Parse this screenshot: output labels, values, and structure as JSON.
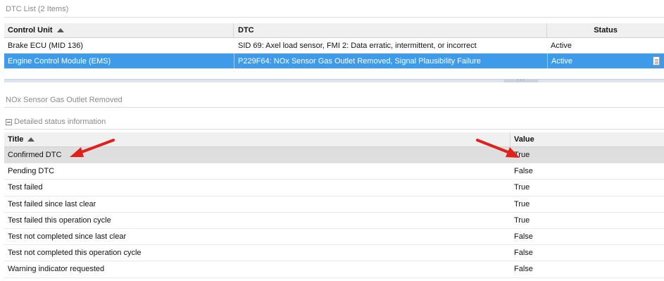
{
  "dtc_list": {
    "title": "DTC List (2 Items)",
    "columns": {
      "control_unit": "Control Unit",
      "dtc": "DTC",
      "status": "Status"
    },
    "rows": [
      {
        "control_unit": "Brake ECU (MID 136)",
        "dtc": "SID 69: Axel load sensor, FMI 2: Data erratic, intermittent, or incorrect",
        "status": "Active",
        "selected": false
      },
      {
        "control_unit": "Engine Control Module (EMS)",
        "dtc": "P229F64: NOx Sensor Gas Outlet Removed, Signal Plausibility Failure",
        "status": "Active",
        "selected": true
      }
    ],
    "splitter_grip": "···"
  },
  "detail": {
    "title": "NOx Sensor Gas Outlet Removed",
    "section_label": "Detailed status information",
    "columns": {
      "title": "Title",
      "value": "Value"
    },
    "rows": [
      {
        "title": "Confirmed DTC",
        "value": "True"
      },
      {
        "title": "Pending DTC",
        "value": "False"
      },
      {
        "title": "Test failed",
        "value": "True"
      },
      {
        "title": "Test failed since last clear",
        "value": "True"
      },
      {
        "title": "Test failed this operation cycle",
        "value": "True"
      },
      {
        "title": "Test not completed since last clear",
        "value": "False"
      },
      {
        "title": "Test not completed this operation cycle",
        "value": "False"
      },
      {
        "title": "Warning indicator requested",
        "value": "False"
      }
    ]
  },
  "colors": {
    "selection": "#3d9be9",
    "highlight_row": "#dedede",
    "annotation_arrow": "#e0201b"
  },
  "icons": {
    "sort": "sort-ascending-icon",
    "doc": "document-icon",
    "collapse": "collapse-minus-icon",
    "arrow": "red-arrow-annotation"
  }
}
